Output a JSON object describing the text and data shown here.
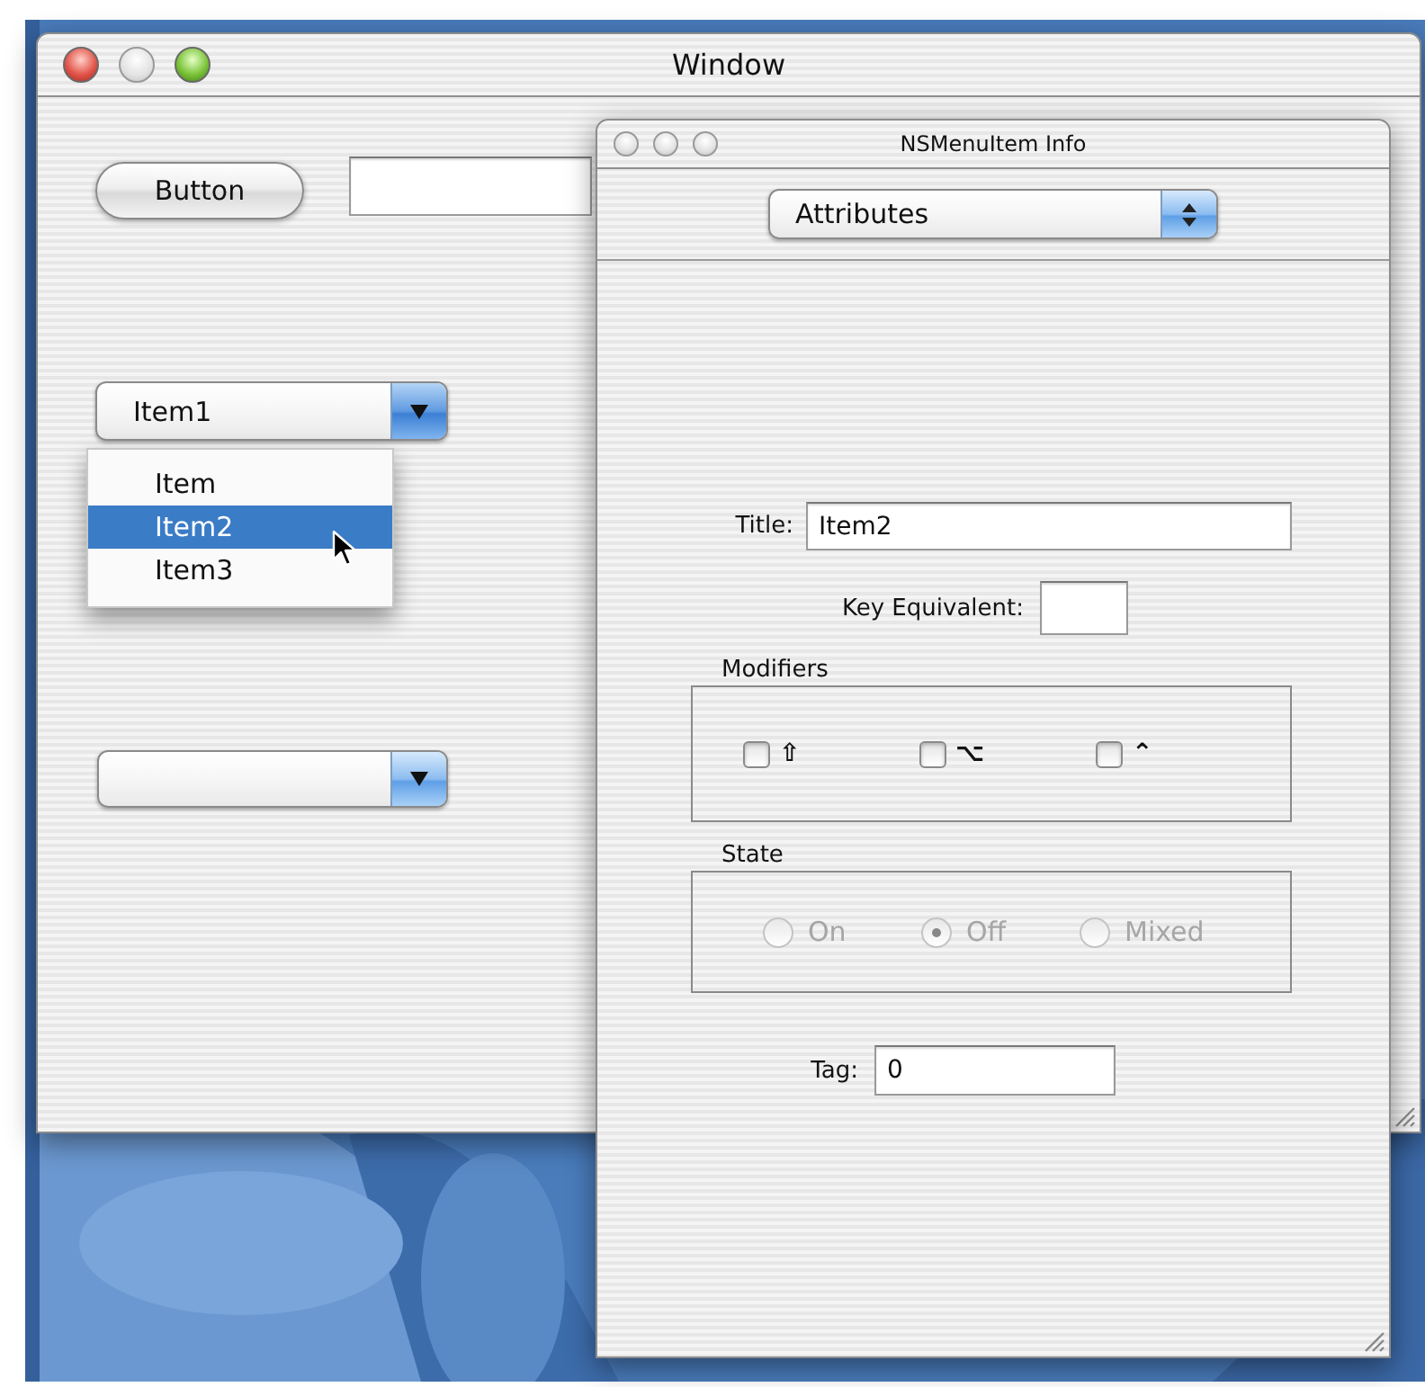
{
  "main_window": {
    "title": "Window",
    "lights": [
      {
        "enabled": true
      },
      {
        "enabled": false
      },
      {
        "enabled": true
      }
    ],
    "button": {
      "label": "Button"
    },
    "popups": [
      {
        "value": "Item1",
        "open": true,
        "menu": [
          {
            "label": "Item",
            "selected": false
          },
          {
            "label": "Item2",
            "selected": true
          },
          {
            "label": "Item3",
            "selected": false
          }
        ]
      },
      {
        "open": false
      }
    ]
  },
  "inspector": {
    "title": "NSMenuItem Info",
    "lights": [
      {
        "enabled": false
      },
      {
        "enabled": false
      },
      {
        "enabled": false
      }
    ],
    "pane": "Attributes",
    "title_field": {
      "label": "Title:",
      "value": "Item2"
    },
    "key_equivalent": {
      "label": "Key Equivalent:"
    },
    "modifiers": {
      "title": "Modifiers",
      "items": [
        {
          "symbol": "⇧",
          "checked": false
        },
        {
          "symbol": "⌥",
          "checked": false
        },
        {
          "symbol": "⌃",
          "checked": false
        }
      ]
    },
    "state": {
      "title": "State",
      "enabled": false,
      "options": [
        {
          "label": "On",
          "selected": false
        },
        {
          "label": "Off",
          "selected": true
        },
        {
          "label": "Mixed",
          "selected": false
        }
      ]
    },
    "tag": {
      "label": "Tag:",
      "value": "0"
    }
  }
}
